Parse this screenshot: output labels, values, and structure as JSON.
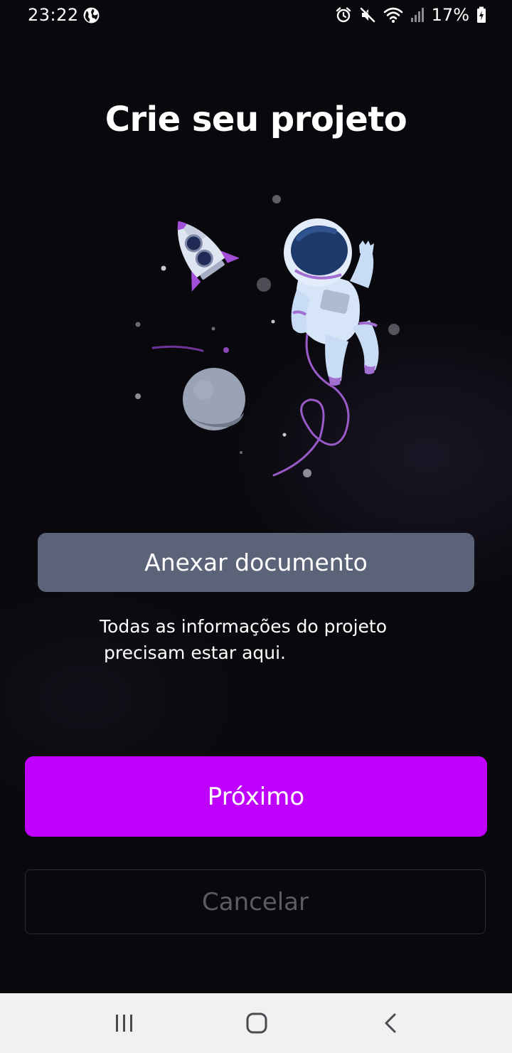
{
  "status_bar": {
    "time": "23:22",
    "battery": "17%",
    "icons": [
      "globe-icon",
      "alarm-icon",
      "mute-icon",
      "wifi-icon",
      "signal-icon",
      "battery-charging-icon"
    ]
  },
  "page": {
    "title": "Crie seu projeto",
    "illustration": "astronaut-rocket-planet-illustration"
  },
  "attach": {
    "label": "Anexar documento"
  },
  "helper": {
    "line1": "Todas as informações do projeto",
    "line2": "precisam estar aqui."
  },
  "actions": {
    "next_label": "Próximo",
    "cancel_label": "Cancelar"
  },
  "nav_bar": {
    "items": [
      "recent-apps-icon",
      "home-icon",
      "back-icon"
    ]
  },
  "colors": {
    "background": "#09080c",
    "attach_button": "#5b6378",
    "primary": "#bf00fd",
    "cancel_text": "#5c5c63",
    "nav_bar": "#f1f1f2"
  }
}
